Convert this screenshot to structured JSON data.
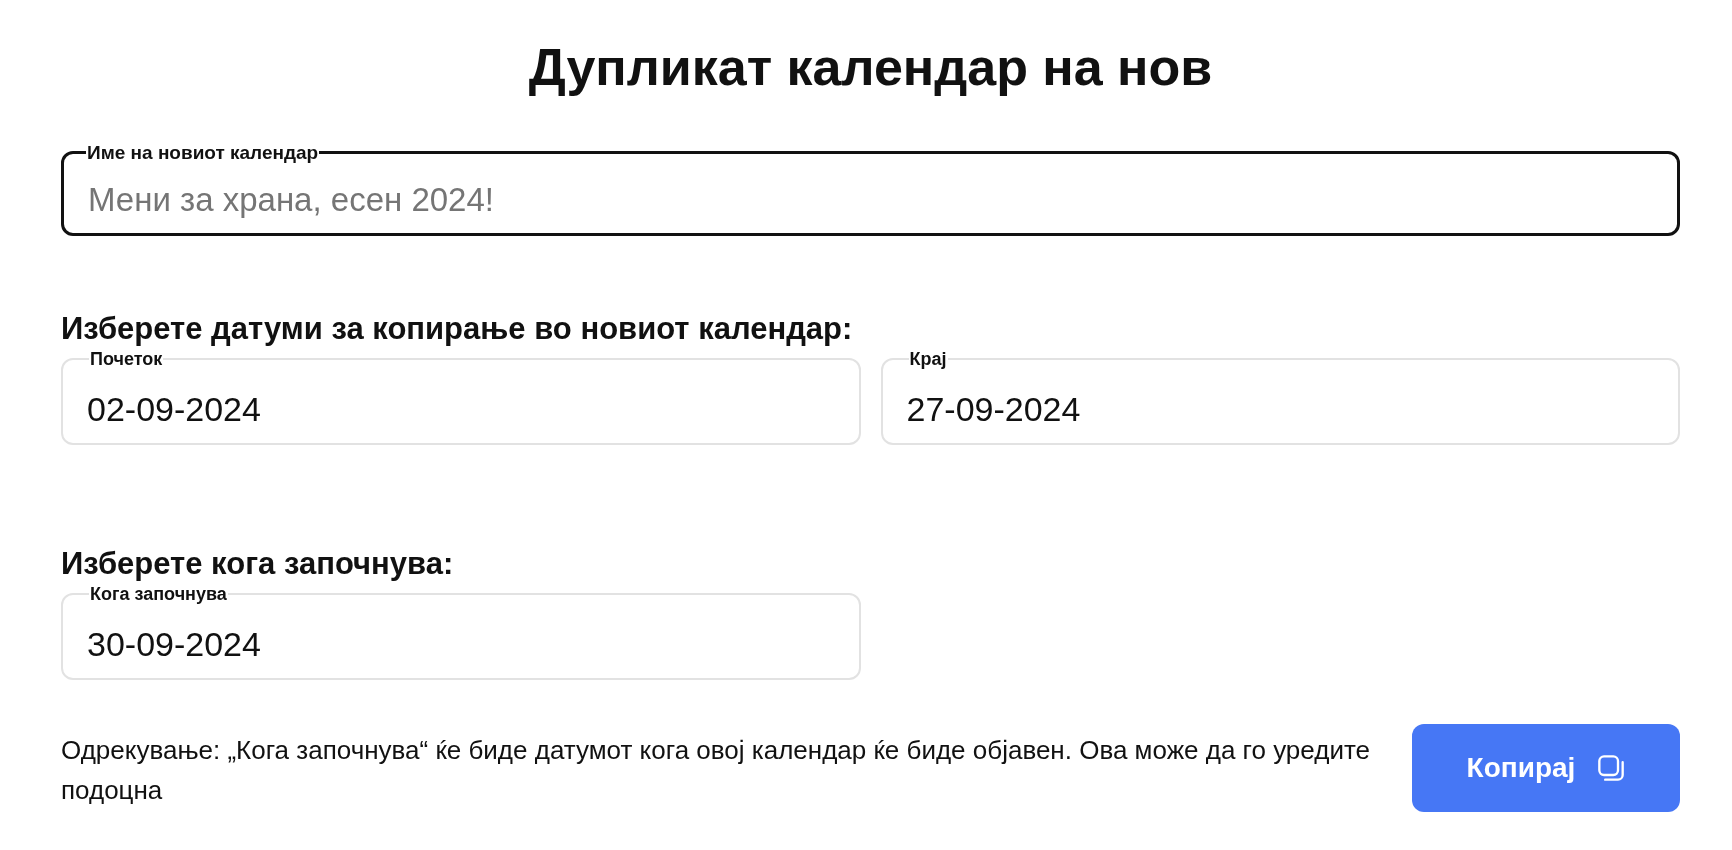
{
  "title": "Дупликат календар на нов",
  "name_field": {
    "label": "Име на новиот календар",
    "placeholder": "Мени за храна, есен 2024!",
    "focused": true
  },
  "dates_section": {
    "heading": "Изберете датуми за копирање во новиот календар:",
    "fields": [
      {
        "label": "Почеток",
        "value": "02-09-2024",
        "focused": false
      },
      {
        "label": "Крај",
        "value": "27-09-2024",
        "focused": false
      }
    ]
  },
  "start_section": {
    "heading": "Изберете кога започнува:",
    "fields": [
      {
        "label": "Кога започнува",
        "value": "30-09-2024",
        "focused": false
      }
    ]
  },
  "disclaimer": "Одрекување: „Кога започнува“ ќе биде датумот кога овој календар ќе биде објавен. Ова може да го уредите подоцна",
  "copy_button": "Копирај"
}
